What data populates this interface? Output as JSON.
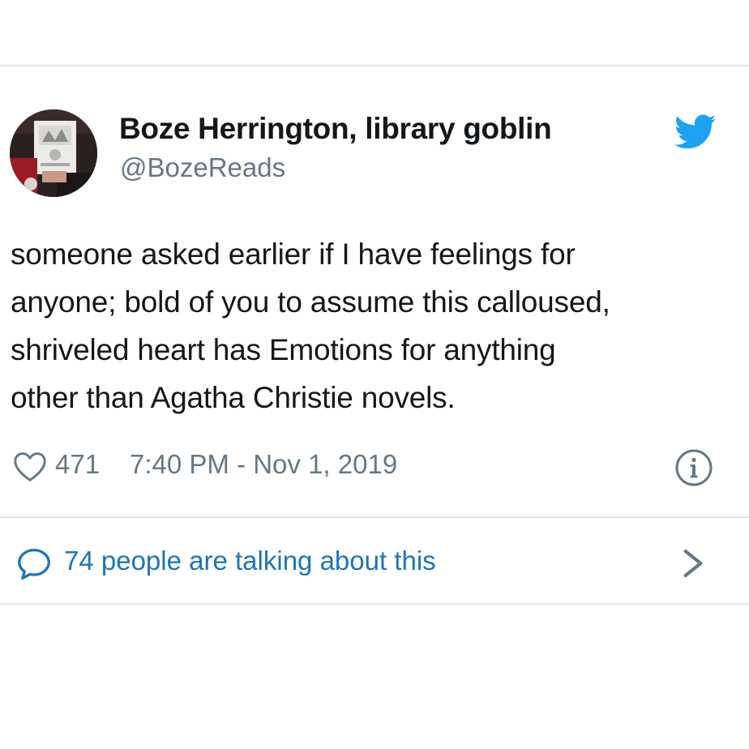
{
  "tweet": {
    "author": {
      "display_name": "Boze Herrington, library goblin",
      "handle": "@BozeReads"
    },
    "text_lines": [
      "someone asked earlier if I have feelings for",
      "anyone; bold of you to assume this calloused,",
      "shriveled heart has Emotions for anything",
      "other than Agatha Christie novels."
    ],
    "like_count": "471",
    "timestamp": "7:40 PM - Nov 1, 2019",
    "conversation_label": "74 people are talking about this"
  },
  "icons": {
    "brand": "twitter-bird-icon",
    "like": "heart-icon",
    "info": "info-icon",
    "reply": "speech-bubble-icon",
    "more": "chevron-right-icon"
  },
  "colors": {
    "twitter_blue": "#1da1f2",
    "link_blue": "#1b75bb",
    "secondary_text": "#657786",
    "primary_text": "#14171a",
    "divider": "#e3e6e9"
  }
}
